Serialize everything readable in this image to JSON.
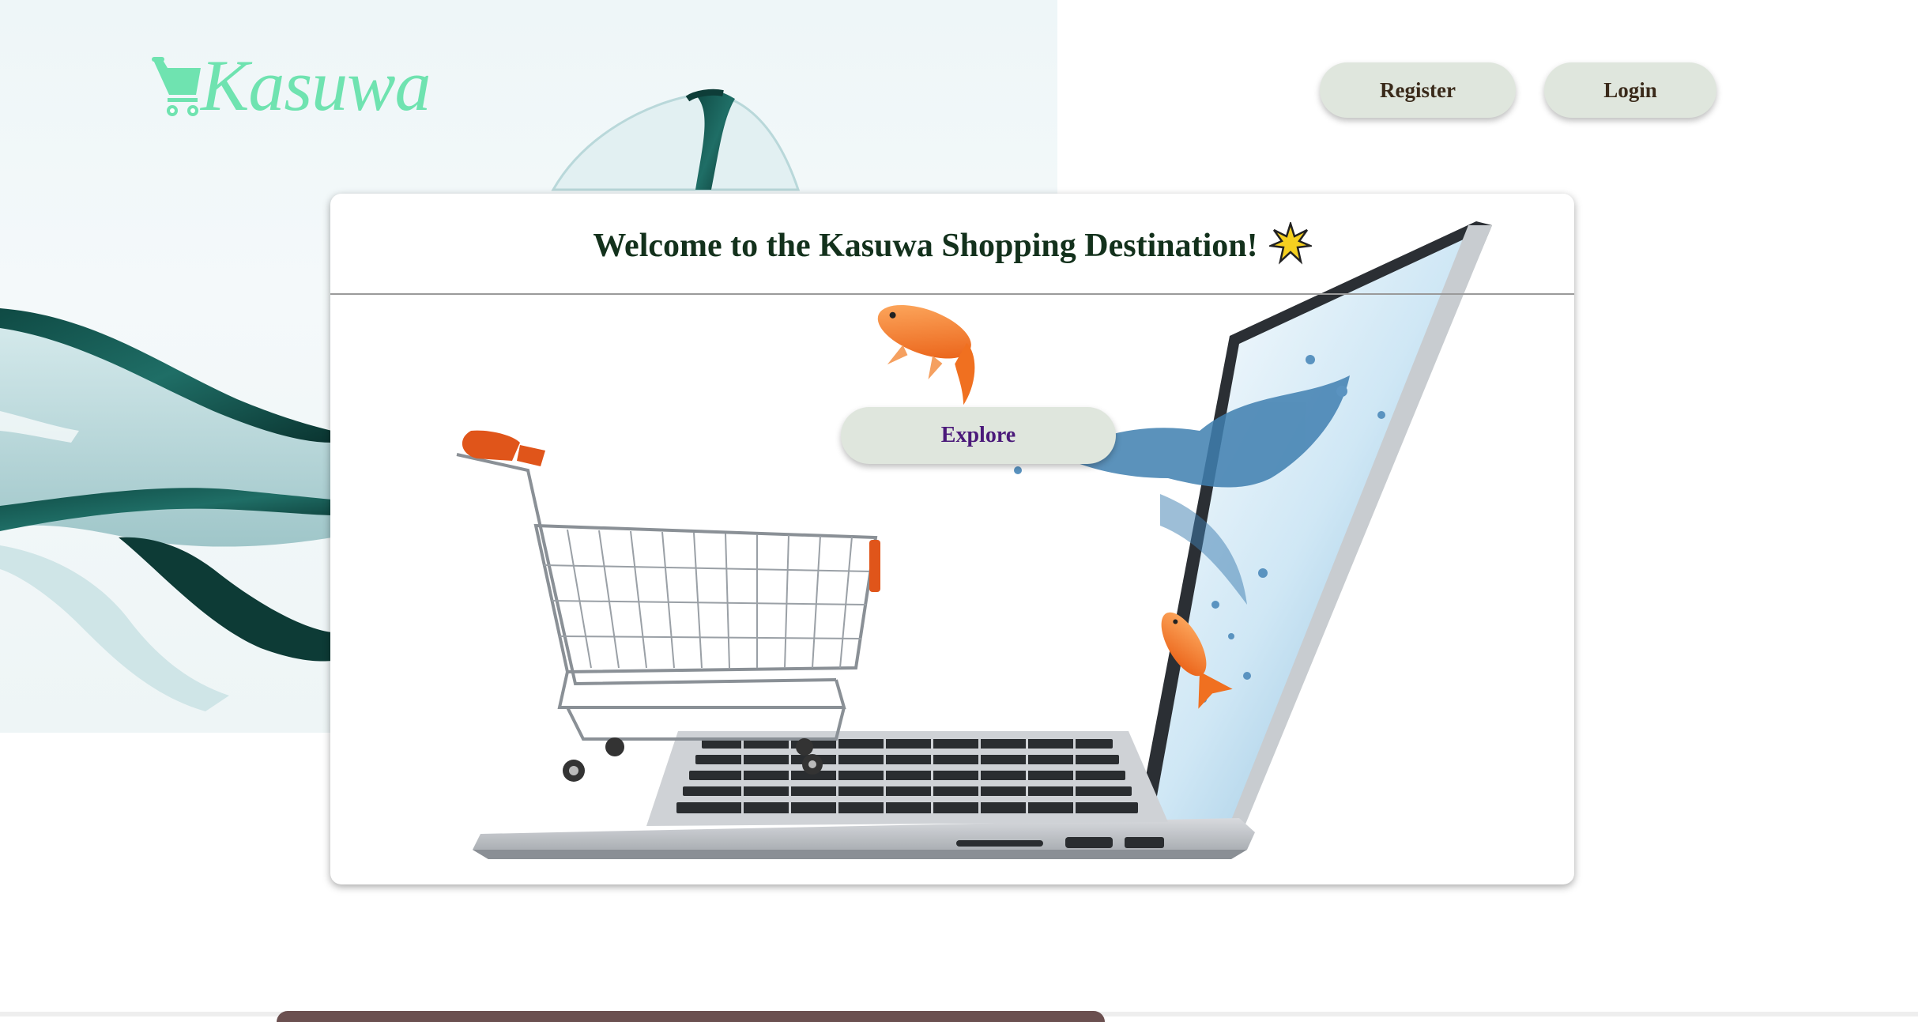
{
  "header": {
    "logo_text": "Kasuwa",
    "logo_color": "#6fe3b0",
    "logo_icon": "shopping-cart-icon",
    "register_label": "Register",
    "login_label": "Login"
  },
  "hero": {
    "title": "Welcome to the Kasuwa Shopping Destination!",
    "title_icon": "star-icon",
    "explore_label": "Explore",
    "explore_color": "#4b1a7a",
    "button_bg": "#dfe6dd"
  }
}
